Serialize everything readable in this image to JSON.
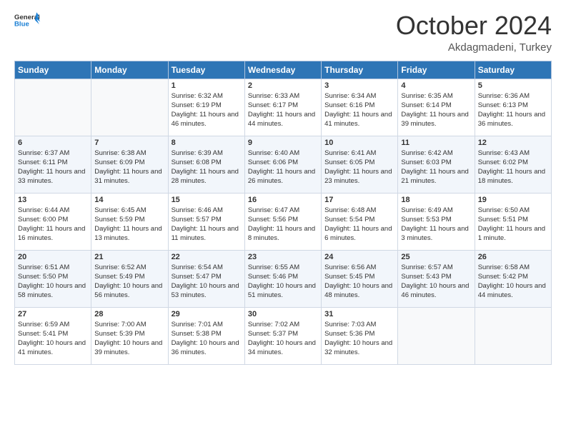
{
  "header": {
    "logo_general": "General",
    "logo_blue": "Blue",
    "month": "October 2024",
    "location": "Akdagmadeni, Turkey"
  },
  "weekdays": [
    "Sunday",
    "Monday",
    "Tuesday",
    "Wednesday",
    "Thursday",
    "Friday",
    "Saturday"
  ],
  "weeks": [
    [
      {
        "day": "",
        "sunrise": "",
        "sunset": "",
        "daylight": ""
      },
      {
        "day": "",
        "sunrise": "",
        "sunset": "",
        "daylight": ""
      },
      {
        "day": "1",
        "sunrise": "Sunrise: 6:32 AM",
        "sunset": "Sunset: 6:19 PM",
        "daylight": "Daylight: 11 hours and 46 minutes."
      },
      {
        "day": "2",
        "sunrise": "Sunrise: 6:33 AM",
        "sunset": "Sunset: 6:17 PM",
        "daylight": "Daylight: 11 hours and 44 minutes."
      },
      {
        "day": "3",
        "sunrise": "Sunrise: 6:34 AM",
        "sunset": "Sunset: 6:16 PM",
        "daylight": "Daylight: 11 hours and 41 minutes."
      },
      {
        "day": "4",
        "sunrise": "Sunrise: 6:35 AM",
        "sunset": "Sunset: 6:14 PM",
        "daylight": "Daylight: 11 hours and 39 minutes."
      },
      {
        "day": "5",
        "sunrise": "Sunrise: 6:36 AM",
        "sunset": "Sunset: 6:13 PM",
        "daylight": "Daylight: 11 hours and 36 minutes."
      }
    ],
    [
      {
        "day": "6",
        "sunrise": "Sunrise: 6:37 AM",
        "sunset": "Sunset: 6:11 PM",
        "daylight": "Daylight: 11 hours and 33 minutes."
      },
      {
        "day": "7",
        "sunrise": "Sunrise: 6:38 AM",
        "sunset": "Sunset: 6:09 PM",
        "daylight": "Daylight: 11 hours and 31 minutes."
      },
      {
        "day": "8",
        "sunrise": "Sunrise: 6:39 AM",
        "sunset": "Sunset: 6:08 PM",
        "daylight": "Daylight: 11 hours and 28 minutes."
      },
      {
        "day": "9",
        "sunrise": "Sunrise: 6:40 AM",
        "sunset": "Sunset: 6:06 PM",
        "daylight": "Daylight: 11 hours and 26 minutes."
      },
      {
        "day": "10",
        "sunrise": "Sunrise: 6:41 AM",
        "sunset": "Sunset: 6:05 PM",
        "daylight": "Daylight: 11 hours and 23 minutes."
      },
      {
        "day": "11",
        "sunrise": "Sunrise: 6:42 AM",
        "sunset": "Sunset: 6:03 PM",
        "daylight": "Daylight: 11 hours and 21 minutes."
      },
      {
        "day": "12",
        "sunrise": "Sunrise: 6:43 AM",
        "sunset": "Sunset: 6:02 PM",
        "daylight": "Daylight: 11 hours and 18 minutes."
      }
    ],
    [
      {
        "day": "13",
        "sunrise": "Sunrise: 6:44 AM",
        "sunset": "Sunset: 6:00 PM",
        "daylight": "Daylight: 11 hours and 16 minutes."
      },
      {
        "day": "14",
        "sunrise": "Sunrise: 6:45 AM",
        "sunset": "Sunset: 5:59 PM",
        "daylight": "Daylight: 11 hours and 13 minutes."
      },
      {
        "day": "15",
        "sunrise": "Sunrise: 6:46 AM",
        "sunset": "Sunset: 5:57 PM",
        "daylight": "Daylight: 11 hours and 11 minutes."
      },
      {
        "day": "16",
        "sunrise": "Sunrise: 6:47 AM",
        "sunset": "Sunset: 5:56 PM",
        "daylight": "Daylight: 11 hours and 8 minutes."
      },
      {
        "day": "17",
        "sunrise": "Sunrise: 6:48 AM",
        "sunset": "Sunset: 5:54 PM",
        "daylight": "Daylight: 11 hours and 6 minutes."
      },
      {
        "day": "18",
        "sunrise": "Sunrise: 6:49 AM",
        "sunset": "Sunset: 5:53 PM",
        "daylight": "Daylight: 11 hours and 3 minutes."
      },
      {
        "day": "19",
        "sunrise": "Sunrise: 6:50 AM",
        "sunset": "Sunset: 5:51 PM",
        "daylight": "Daylight: 11 hours and 1 minute."
      }
    ],
    [
      {
        "day": "20",
        "sunrise": "Sunrise: 6:51 AM",
        "sunset": "Sunset: 5:50 PM",
        "daylight": "Daylight: 10 hours and 58 minutes."
      },
      {
        "day": "21",
        "sunrise": "Sunrise: 6:52 AM",
        "sunset": "Sunset: 5:49 PM",
        "daylight": "Daylight: 10 hours and 56 minutes."
      },
      {
        "day": "22",
        "sunrise": "Sunrise: 6:54 AM",
        "sunset": "Sunset: 5:47 PM",
        "daylight": "Daylight: 10 hours and 53 minutes."
      },
      {
        "day": "23",
        "sunrise": "Sunrise: 6:55 AM",
        "sunset": "Sunset: 5:46 PM",
        "daylight": "Daylight: 10 hours and 51 minutes."
      },
      {
        "day": "24",
        "sunrise": "Sunrise: 6:56 AM",
        "sunset": "Sunset: 5:45 PM",
        "daylight": "Daylight: 10 hours and 48 minutes."
      },
      {
        "day": "25",
        "sunrise": "Sunrise: 6:57 AM",
        "sunset": "Sunset: 5:43 PM",
        "daylight": "Daylight: 10 hours and 46 minutes."
      },
      {
        "day": "26",
        "sunrise": "Sunrise: 6:58 AM",
        "sunset": "Sunset: 5:42 PM",
        "daylight": "Daylight: 10 hours and 44 minutes."
      }
    ],
    [
      {
        "day": "27",
        "sunrise": "Sunrise: 6:59 AM",
        "sunset": "Sunset: 5:41 PM",
        "daylight": "Daylight: 10 hours and 41 minutes."
      },
      {
        "day": "28",
        "sunrise": "Sunrise: 7:00 AM",
        "sunset": "Sunset: 5:39 PM",
        "daylight": "Daylight: 10 hours and 39 minutes."
      },
      {
        "day": "29",
        "sunrise": "Sunrise: 7:01 AM",
        "sunset": "Sunset: 5:38 PM",
        "daylight": "Daylight: 10 hours and 36 minutes."
      },
      {
        "day": "30",
        "sunrise": "Sunrise: 7:02 AM",
        "sunset": "Sunset: 5:37 PM",
        "daylight": "Daylight: 10 hours and 34 minutes."
      },
      {
        "day": "31",
        "sunrise": "Sunrise: 7:03 AM",
        "sunset": "Sunset: 5:36 PM",
        "daylight": "Daylight: 10 hours and 32 minutes."
      },
      {
        "day": "",
        "sunrise": "",
        "sunset": "",
        "daylight": ""
      },
      {
        "day": "",
        "sunrise": "",
        "sunset": "",
        "daylight": ""
      }
    ]
  ]
}
